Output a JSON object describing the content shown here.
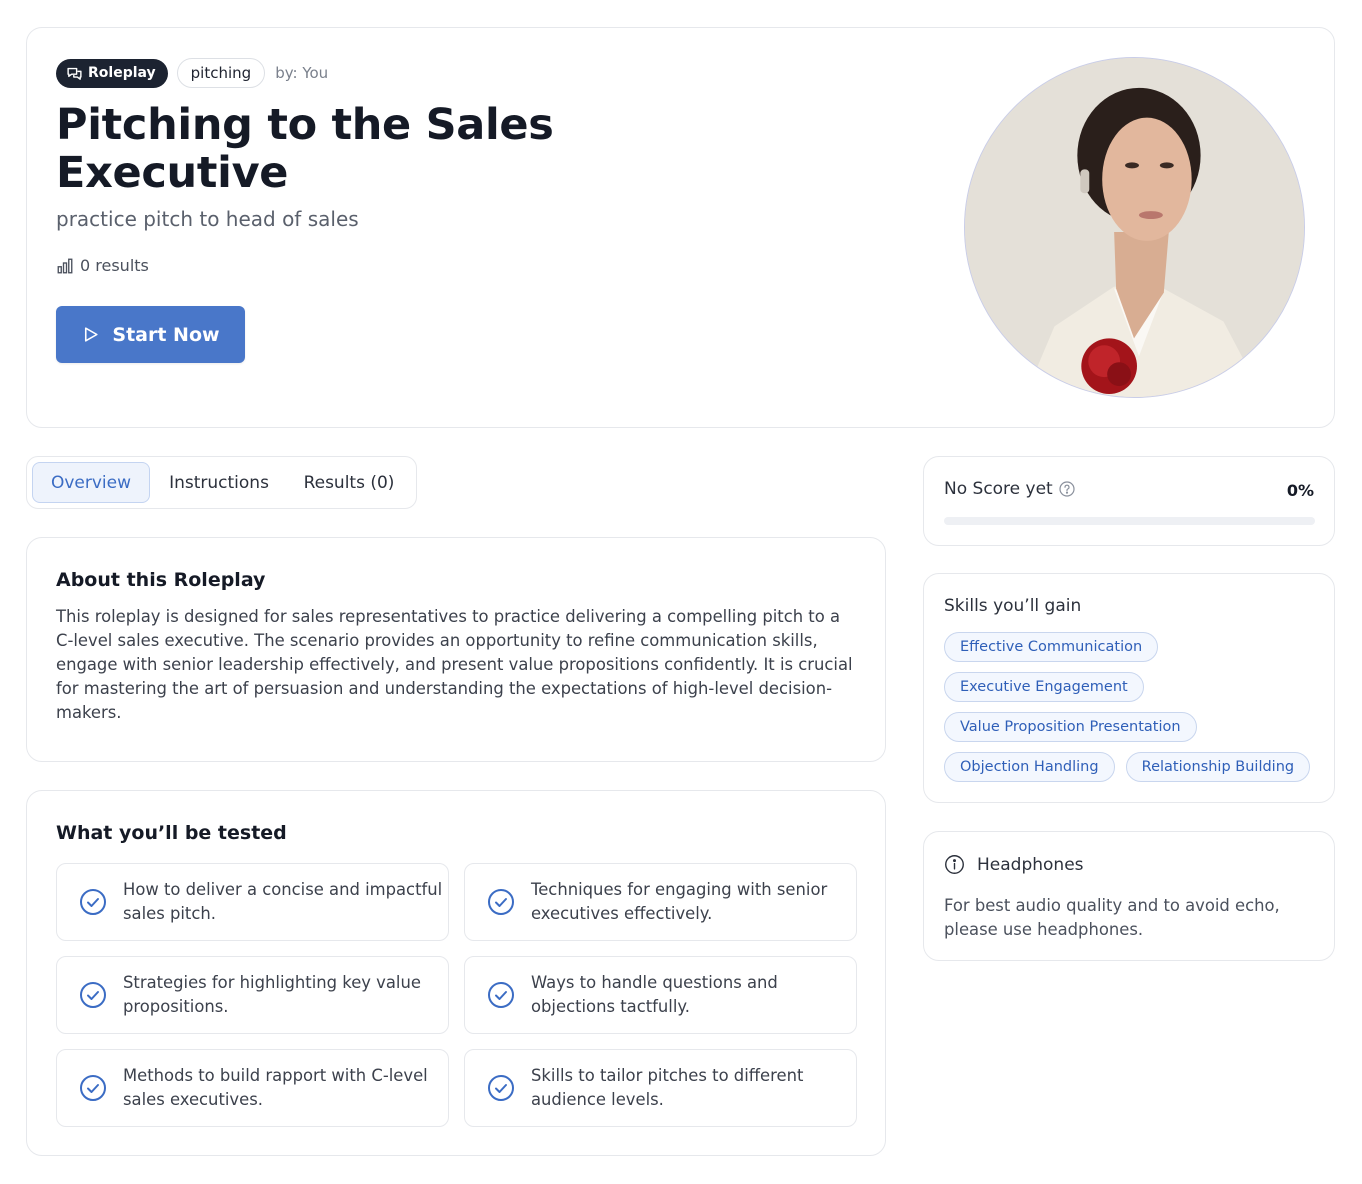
{
  "header": {
    "tag_primary": "Roleplay",
    "tag_primary_icon": "chat-bubbles-icon",
    "tag_secondary": "pitching",
    "author": "by: You",
    "title": "Pitching to the Sales Executive",
    "subtitle": "practice pitch to head of sales",
    "results": "0 results",
    "results_icon": "bar-chart-icon",
    "start_button": "Start Now",
    "start_icon": "play-icon",
    "accent_color": "#4977c9"
  },
  "tabs": [
    {
      "label": "Overview",
      "active": true
    },
    {
      "label": "Instructions",
      "active": false
    },
    {
      "label": "Results (0)",
      "active": false
    }
  ],
  "about": {
    "heading": "About this Roleplay",
    "text": "This roleplay is designed for sales representatives to practice delivering a compelling pitch to a C-level sales executive. The scenario provides an opportunity to refine communication skills, engage with senior leadership effectively, and present value propositions confidently. It is crucial for mastering the art of persuasion and understanding the expectations of high-level decision-makers."
  },
  "tested": {
    "heading": "What you’ll be tested",
    "items": [
      "How to deliver a concise and impactful sales pitch.",
      "Techniques for engaging with senior executives effectively.",
      "Strategies for highlighting key value propositions.",
      "Ways to handle questions and objections tactfully.",
      "Methods to build rapport with C-level sales executives.",
      "Skills to tailor pitches to different audience levels."
    ]
  },
  "score": {
    "label": "No Score yet",
    "value": "0%",
    "progress": 0
  },
  "skills": {
    "heading": "Skills you’ll gain",
    "chips": [
      "Effective Communication",
      "Executive Engagement",
      "Value Proposition Presentation",
      "Objection Handling",
      "Relationship Building"
    ]
  },
  "headphones": {
    "heading": "Headphones",
    "text": "For best audio quality and to avoid echo, please use headphones."
  }
}
